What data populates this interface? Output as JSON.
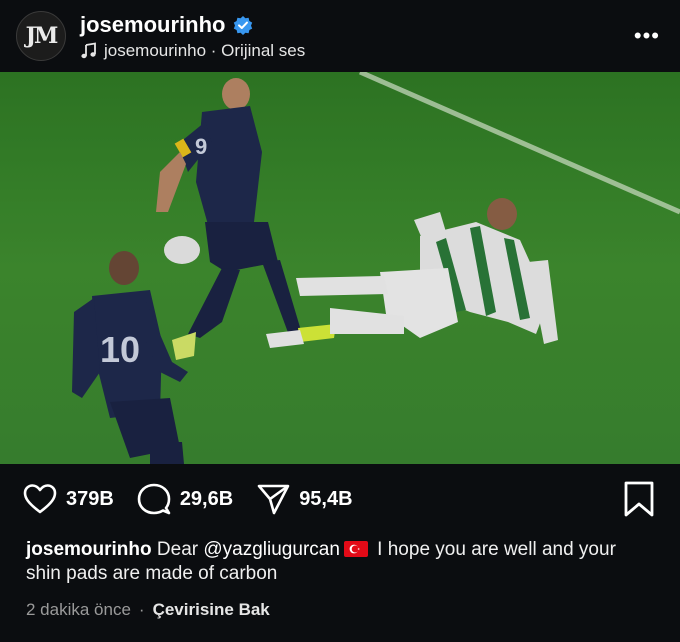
{
  "post": {
    "username": "josemourinho",
    "audio": "josemourinho · Orijinal ses",
    "more_label": "•••"
  },
  "actions": {
    "likes": "379B",
    "comments": "29,6B",
    "shares": "95,4B"
  },
  "caption": {
    "username": "josemourinho",
    "text_before": "Dear ",
    "mention": "@yazgliugurcan",
    "text_after": " I hope you are well and your shin pads are made of carbon"
  },
  "meta": {
    "time": "2 dakika önce",
    "dot": "·",
    "translate": "Çevirisine Bak"
  },
  "colors": {
    "background": "#0b0d10",
    "verified": "#3897f0",
    "pitch": "#3e8a2e",
    "flag_red": "#e30a17"
  },
  "icons": {
    "avatar": "mourinho-logo",
    "verified": "verified-badge-icon",
    "audio": "music-note-icon",
    "like": "heart-icon",
    "comment": "comment-icon",
    "share": "send-icon",
    "save": "bookmark-icon"
  }
}
